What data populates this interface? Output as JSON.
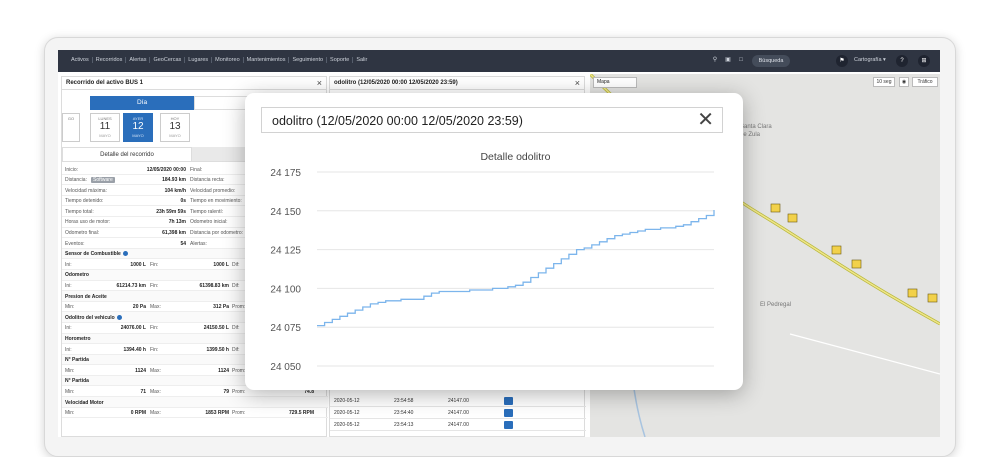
{
  "topbar": {
    "menu": [
      "Activos",
      "Recorridos",
      "Alertas",
      "GeoCercas",
      "Lugares",
      "Monitoreo",
      "Mantenimientos",
      "Seguimiento",
      "Soporte",
      "Salir"
    ],
    "search_label": "Búsqueda",
    "cartography_label": "Cartografía ▾"
  },
  "left_panel": {
    "title": "Recorrido del activo BUS 1",
    "tab_day": "Día",
    "tab_range": "Ra",
    "days": [
      {
        "name": "GO",
        "num": "",
        "month": ""
      },
      {
        "name": "LUNES",
        "num": "11",
        "month": "MAYO"
      },
      {
        "name": "AYER",
        "num": "12",
        "month": "MAYO"
      },
      {
        "name": "HOY",
        "num": "13",
        "month": "MAYO"
      }
    ],
    "subtab_detail": "Detalle del recorrido",
    "subtab_other": "Deta",
    "rows": [
      {
        "l": "Inicio:",
        "v": "12/05/2020 00:00",
        "l2": "Final:"
      },
      {
        "l": "Distancia:",
        "badge": "Software",
        "v": "184.93 km",
        "l2": "Distancia recta:"
      },
      {
        "l": "Velocidad máxima:",
        "v": "104 km/h",
        "l2": "Velocidad promedio:"
      },
      {
        "l": "Tiempo detenido:",
        "v": "0s",
        "l2": "Tiempo en movimiento:"
      },
      {
        "l": "Tiempo total:",
        "v": "23h 59m 59s",
        "l2": "Tiempo ralentí:"
      },
      {
        "l": "Horas uso de motor:",
        "v": "7h 13m",
        "l2": "Odometro inicial:"
      },
      {
        "l": "Odometro final:",
        "v": "61,398 km",
        "l2": "Distancia por odometro:"
      },
      {
        "l": "Eventos:",
        "v": "54",
        "l2": "Alertas:"
      }
    ],
    "sections": [
      {
        "title": "Sensor de Combustible",
        "a": "Ini:",
        "av": "1000 L",
        "b": "Fin:",
        "bv": "1000 L",
        "c": "Dif:"
      },
      {
        "title": "Odometro",
        "a": "Ini:",
        "av": "61214.73 km",
        "b": "Fin:",
        "bv": "61398.83 km",
        "c": "Dif:"
      },
      {
        "title": "Presion de Aceite",
        "a": "Min:",
        "av": "20 Pa",
        "b": "Max:",
        "bv": "312 Pa",
        "c": "Prom:"
      },
      {
        "title": "Odolitro del vehiculo",
        "a": "Ini:",
        "av": "24076.00 L",
        "b": "Fin:",
        "bv": "24150.50 L",
        "c": "Dif:"
      },
      {
        "title": "Horometro",
        "a": "Ini:",
        "av": "1394.40 h",
        "b": "Fin:",
        "bv": "1399.50 h",
        "c": "Dif:"
      },
      {
        "title": "N° Partida",
        "a": "Min:",
        "av": "1124",
        "b": "Max:",
        "bv": "1124",
        "c": "Prom:"
      },
      {
        "title": "N° Partida",
        "a": "Min:",
        "av": "71",
        "b": "Max:",
        "bv": "79",
        "c": "Prom:",
        "cv": "74.8"
      },
      {
        "title": "Velocidad Motor",
        "a": "Min:",
        "av": "0 RPM",
        "b": "Max:",
        "bv": "1853 RPM",
        "c": "Prom:",
        "cv": "729.5 RPM"
      }
    ]
  },
  "mid_panel": {
    "title": "odolitro (12/05/2020 00:00 12/05/2020 23:59)",
    "rows": [
      {
        "date": "2020-05-12",
        "time": "23:54:58",
        "val": "24147.00"
      },
      {
        "date": "2020-05-12",
        "time": "23:54:40",
        "val": "24147.00"
      },
      {
        "date": "2020-05-12",
        "time": "23:54:13",
        "val": "24147.00"
      }
    ]
  },
  "map": {
    "type_label": "Mapa",
    "interval_label": "10 seg",
    "traffic_label": "Tráfico",
    "place_1": "Santa Clara",
    "place_2": "de Zula",
    "place_3": "El Pedregal"
  },
  "modal": {
    "title": "odolitro (12/05/2020 00:00 12/05/2020 23:59)"
  },
  "chart_data": {
    "type": "line",
    "title": "Detalle odolitro",
    "ylim": [
      24050,
      24175
    ],
    "yticks": [
      "24 175",
      "24 150",
      "24 125",
      "24 100",
      "24 075",
      "24 050"
    ],
    "ytick_values": [
      24175,
      24150,
      24125,
      24100,
      24075,
      24050
    ],
    "line_color": "#7cb5ec",
    "series": [
      {
        "values": [
          24076,
          24078,
          24080,
          24082,
          24084,
          24086,
          24088,
          24090,
          24091,
          24092,
          24092,
          24093,
          24093,
          24093,
          24095,
          24097,
          24098,
          24098,
          24098,
          24098,
          24099,
          24099,
          24099,
          24100,
          24100,
          24101,
          24102,
          24104,
          24107,
          24110,
          24113,
          24116,
          24119,
          24122,
          24125,
          24126,
          24128,
          24130,
          24132,
          24134,
          24135,
          24136,
          24137,
          24138,
          24138,
          24139,
          24139,
          24140,
          24141,
          24143,
          24145,
          24147,
          24150.5
        ]
      }
    ]
  }
}
